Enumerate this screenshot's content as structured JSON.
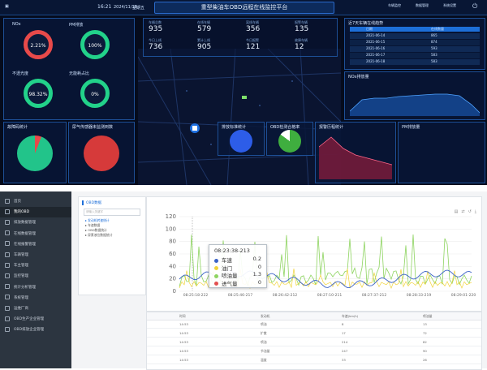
{
  "header": {
    "title": "重型柴油车OBD远程在线监控平台",
    "time": "16:21",
    "date": "2024/11/18",
    "weekday": "星期五",
    "nav": [
      "车辆监控",
      "数据管理",
      "系统设置"
    ]
  },
  "gauges": [
    {
      "label": "NOx",
      "value": "2.21%",
      "color": "#e84a4a"
    },
    {
      "label": "PM排放",
      "value": "100%",
      "color": "#22d28a"
    },
    {
      "label": "不透光度",
      "value": "98.32%",
      "color": "#22d28a"
    },
    {
      "label": "无能耗占比",
      "value": "0%",
      "color": "#22d28a"
    }
  ],
  "stats": [
    {
      "value": "935",
      "label": "车辆总数"
    },
    {
      "value": "579",
      "label": "在线车辆"
    },
    {
      "value": "356",
      "label": "离线车辆"
    },
    {
      "value": "135",
      "label": "报警车辆"
    },
    {
      "value": "736",
      "label": "今日上线"
    },
    {
      "value": "905",
      "label": "累计上线"
    },
    {
      "value": "121",
      "label": "今日报警"
    },
    {
      "value": "12",
      "label": "故障车辆"
    }
  ],
  "recent": {
    "title": "近7天车辆在线趋势",
    "headers": [
      "日期",
      "在线数量"
    ],
    "rows": [
      [
        "2021-06-14",
        "865"
      ],
      [
        "2021-06-15",
        "874"
      ],
      [
        "2021-06-16",
        "593"
      ],
      [
        "2021-06-17",
        "583"
      ],
      [
        "2021-06-18",
        "583"
      ]
    ]
  },
  "panels": {
    "nox_trend": "NOx排放量",
    "fault": "故障码统计",
    "oxygen": "尿气传感器未监测到数",
    "ratio": "排放标准统计",
    "obd_rate": "OBD检测合格率",
    "alarm": "报警历程统计",
    "pm_stats": "PM排放量"
  },
  "admin": {
    "sidebar": [
      "首页",
      "我的OBD",
      "排放数据管理",
      "在线数据管理",
      "在线报警管理",
      "车辆管理",
      "车主管理",
      "监控管理",
      "统计分析管理",
      "系统管理",
      "运维厂商",
      "OBD生产企业管理",
      "OBD排放企业管理"
    ],
    "tree_title": "OBD数据",
    "tree_search": "请输入关键字",
    "tree_items": [
      "发动机转速统计",
      "车速数据",
      "OBD数据统计",
      "尿素液位数据统计"
    ],
    "chart": {
      "toolbar": [
        "数据视图",
        "切换",
        "还原",
        "保存"
      ],
      "y_ticks": [
        "120",
        "100",
        "80",
        "60",
        "40",
        "20",
        "0"
      ],
      "x_ticks": [
        "08:25:18-222",
        "08:25:46-217",
        "08:26:42-212",
        "08:27:10-211",
        "08:27:37-212",
        "08:28:33-219",
        "08:29:01-220"
      ]
    },
    "tooltip": {
      "time": "08:23:38-213",
      "rows": [
        {
          "name": "车速",
          "value": "0.2",
          "color": "#3b63c7"
        },
        {
          "name": "油门",
          "value": "0",
          "color": "#f1d43c"
        },
        {
          "name": "喷油量",
          "value": "1.3",
          "color": "#8ed460"
        },
        {
          "name": "进气量",
          "value": "0",
          "color": "#e34f4f"
        }
      ]
    },
    "table": {
      "headers": [
        "时间",
        "发动机",
        "车速(km/h)",
        "喷油量"
      ],
      "rows": [
        [
          "14:53",
          "喷油",
          "8",
          "13"
        ],
        [
          "14:53",
          "扩散",
          "17",
          "72"
        ],
        [
          "14:53",
          "喷油",
          "214",
          "82"
        ],
        [
          "14:53",
          "节油量",
          "247",
          "90"
        ],
        [
          "14:53",
          "温度",
          "33",
          "26"
        ]
      ]
    }
  }
}
